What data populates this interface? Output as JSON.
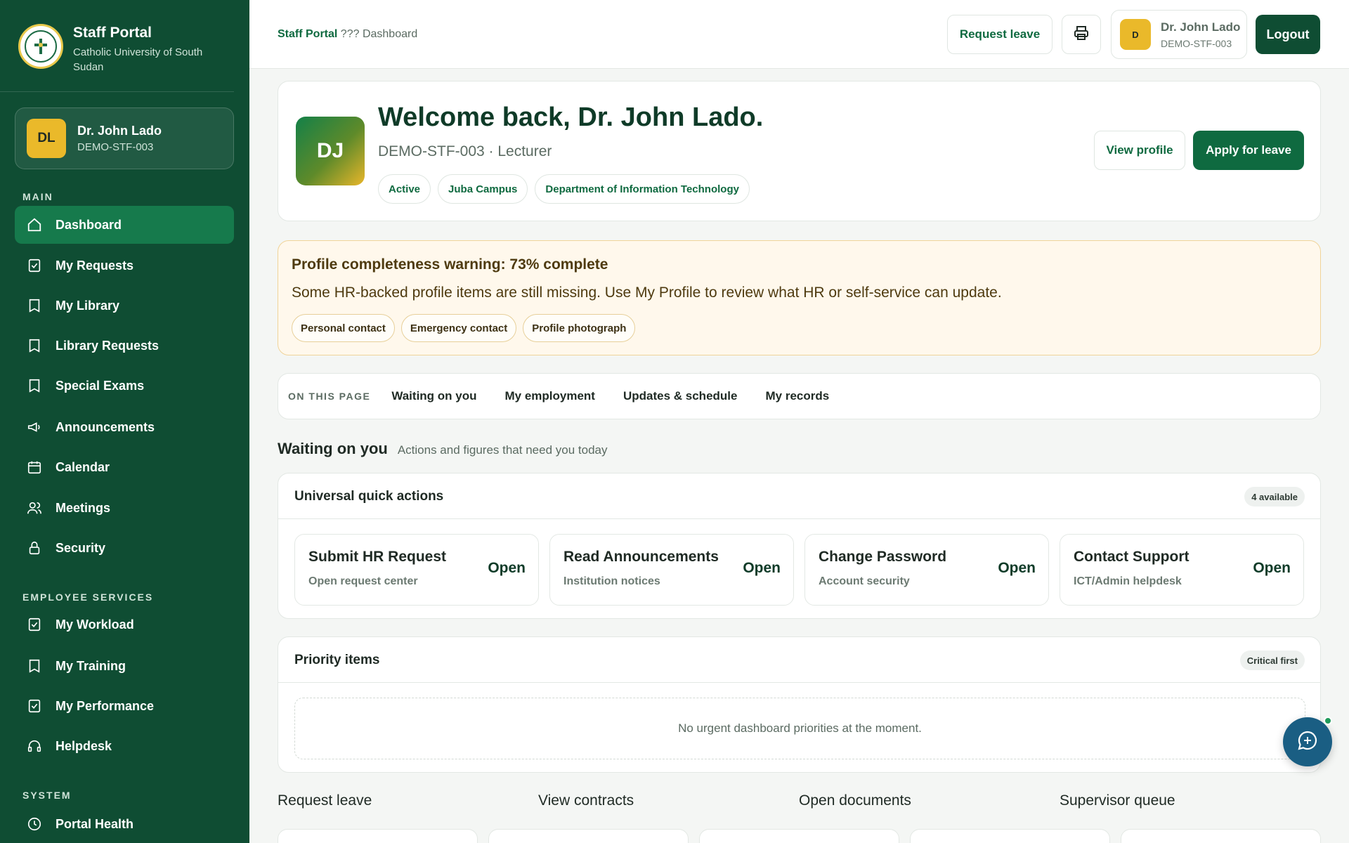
{
  "sidebar": {
    "brand_title": "Staff Portal",
    "brand_sub": "Catholic University of South Sudan",
    "user_initials": "DL",
    "user_name": "Dr. John Lado",
    "user_id": "DEMO-STF-003",
    "sections": {
      "main": "MAIN",
      "employee": "EMPLOYEE SERVICES",
      "system": "SYSTEM"
    },
    "items": {
      "dashboard": "Dashboard",
      "my_requests": "My Requests",
      "my_library": "My Library",
      "library_requests": "Library Requests",
      "special_exams": "Special Exams",
      "announcements": "Announcements",
      "calendar": "Calendar",
      "meetings": "Meetings",
      "security": "Security",
      "my_workload": "My Workload",
      "my_training": "My Training",
      "my_performance": "My Performance",
      "helpdesk": "Helpdesk",
      "portal_health": "Portal Health"
    }
  },
  "topbar": {
    "breadcrumb_root": "Staff Portal",
    "breadcrumb_sep": "???",
    "breadcrumb_current": "Dashboard",
    "request_leave": "Request leave",
    "user_initial": "D",
    "user_name": "Dr. John Lado",
    "user_id": "DEMO-STF-003",
    "logout": "Logout"
  },
  "welcome": {
    "initials": "DJ",
    "title": "Welcome back, Dr. John Lado.",
    "subtitle": "DEMO-STF-003 · Lecturer",
    "chips": [
      "Active",
      "Juba Campus",
      "Department of Information Technology"
    ],
    "view_profile": "View profile",
    "apply_leave": "Apply for leave"
  },
  "warning": {
    "title": "Profile completeness warning: 73% complete",
    "text": "Some HR-backed profile items are still missing. Use My Profile to review what HR or self-service can update.",
    "chips": [
      "Personal contact",
      "Emergency contact",
      "Profile photograph"
    ]
  },
  "onpage": {
    "label": "ON THIS PAGE",
    "links": [
      "Waiting on you",
      "My employment",
      "Updates & schedule",
      "My records"
    ]
  },
  "waiting": {
    "title": "Waiting on you",
    "subtitle": "Actions and figures that need you today"
  },
  "quick_actions": {
    "title": "Universal quick actions",
    "badge": "4 available",
    "tiles": [
      {
        "title": "Submit HR Request",
        "sub": "Open request center",
        "action": "Open"
      },
      {
        "title": "Read Announcements",
        "sub": "Institution notices",
        "action": "Open"
      },
      {
        "title": "Change Password",
        "sub": "Account security",
        "action": "Open"
      },
      {
        "title": "Contact Support",
        "sub": "ICT/Admin helpdesk",
        "action": "Open"
      }
    ]
  },
  "priority": {
    "title": "Priority items",
    "badge": "Critical first",
    "empty": "No urgent dashboard priorities at the moment."
  },
  "bottom_links": [
    "Request leave",
    "View contracts",
    "Open documents",
    "Supervisor queue"
  ],
  "icons": {
    "brand": "university-seal-icon",
    "print": "printer-icon",
    "chat": "chat-bubble-icon"
  },
  "colors": {
    "sidebar": "#0f4d33",
    "accent": "#0f6a40",
    "active": "#167a4c",
    "gold": "#eab92a",
    "warning_bg": "#fff8ec"
  }
}
